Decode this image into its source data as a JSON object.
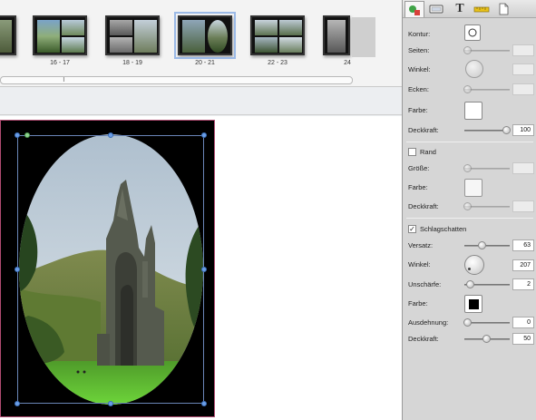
{
  "filmstrip": {
    "thumbs": [
      {
        "label": ""
      },
      {
        "label": "16 - 17"
      },
      {
        "label": "18 - 19"
      },
      {
        "label": "20 - 21"
      },
      {
        "label": "22 - 23"
      },
      {
        "label": "24"
      }
    ],
    "scroll_grip": "|||"
  },
  "tabs": [
    {
      "icon": "effects-icon"
    },
    {
      "icon": "frame-icon"
    },
    {
      "icon": "text-icon",
      "glyph": "T"
    },
    {
      "icon": "ruler-icon"
    },
    {
      "icon": "page-icon"
    }
  ],
  "panel": {
    "kontur": "Kontur:",
    "seiten": "Seiten:",
    "winkel": "Winkel:",
    "ecken": "Ecken:",
    "farbe": "Farbe:",
    "deckkraft": "Deckkraft:",
    "deckkraft_value": "100",
    "rand": {
      "label": "Rand",
      "checked": false,
      "groesse": "Größe:",
      "farbe": "Farbe:",
      "deckkraft": "Deckkraft:"
    },
    "schatten": {
      "label": "Schlagschatten",
      "checkmark": "✓",
      "versatz": "Versatz:",
      "versatz_value": "63",
      "winkel": "Winkel:",
      "winkel_value": "207",
      "unschaerfe": "Unschärfe:",
      "unschaerfe_value": "2",
      "farbe": "Farbe:",
      "farbe_value": "#000000",
      "ausdehnung": "Ausdehnung:",
      "ausdehnung_value": "0",
      "deckkraft": "Deckkraft:",
      "deckkraft_value": "50"
    }
  }
}
